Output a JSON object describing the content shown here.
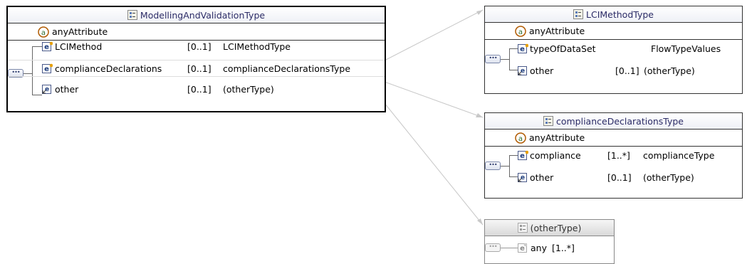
{
  "main": {
    "title": "ModellingAndValidationType",
    "attribute": "anyAttribute",
    "rows": [
      {
        "name": "LCIMethod",
        "card": "[0..1]",
        "type": "LCIMethodType"
      },
      {
        "name": "complianceDeclarations",
        "card": "[0..1]",
        "type": "complianceDeclarationsType"
      },
      {
        "name": "other",
        "card": "[0..1]",
        "type": "(otherType)"
      }
    ]
  },
  "lci": {
    "title": "LCIMethodType",
    "attribute": "anyAttribute",
    "rows": [
      {
        "name": "typeOfDataSet",
        "card": "",
        "type": "FlowTypeValues"
      },
      {
        "name": "other",
        "card": "[0..1]",
        "type": "(otherType)"
      }
    ]
  },
  "compliance": {
    "title": "complianceDeclarationsType",
    "attribute": "anyAttribute",
    "rows": [
      {
        "name": "compliance",
        "card": "[1..*]",
        "type": "complianceType"
      },
      {
        "name": "other",
        "card": "[0..1]",
        "type": "(otherType)"
      }
    ]
  },
  "other": {
    "title": "(otherType)",
    "rows": [
      {
        "name": "any",
        "card": "[1..*]"
      }
    ]
  }
}
